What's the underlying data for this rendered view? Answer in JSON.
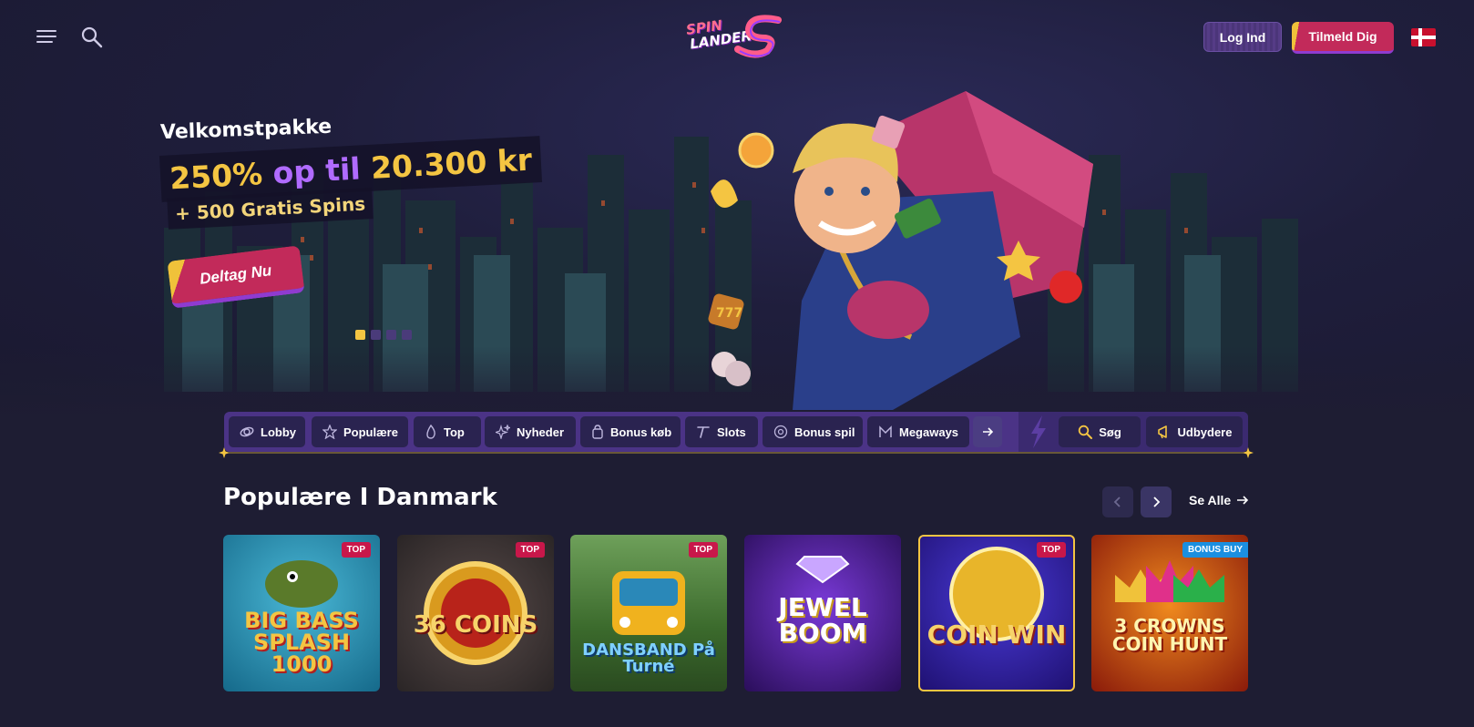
{
  "header": {
    "logo_line1": "SPIN",
    "logo_line2": "LANDER",
    "login_label": "Log Ind",
    "signup_label": "Tilmeld Dig",
    "language_flag": "denmark-flag"
  },
  "hero": {
    "label": "Velkomstpakke",
    "offer_part1": "250%",
    "offer_part2": "op til",
    "offer_part3": "20.300 kr",
    "spins": "+ 500 Gratis Spins",
    "cta_label": "Deltag Nu",
    "slides_total": 4,
    "slide_active": 1
  },
  "categories": [
    {
      "label": "Lobby",
      "icon": "lobby-icon"
    },
    {
      "label": "Populære",
      "icon": "star-icon"
    },
    {
      "label": "Top",
      "icon": "flame-icon"
    },
    {
      "label": "Nyheder",
      "icon": "sparkle-icon"
    },
    {
      "label": "Bonus køb",
      "icon": "bag-icon"
    },
    {
      "label": "Slots",
      "icon": "slot-icon"
    },
    {
      "label": "Bonus spil",
      "icon": "coin-icon"
    },
    {
      "label": "Megaways",
      "icon": "megaways-icon"
    }
  ],
  "category_tools": {
    "search_label": "Søg",
    "providers_label": "Udbydere"
  },
  "section": {
    "title": "Populære I Danmark",
    "see_all_label": "Se Alle"
  },
  "games": [
    {
      "title": "BIG BASS SPLASH 1000",
      "badge": "TOP",
      "bg": "#1d8fb0"
    },
    {
      "title": "36 COINS",
      "badge": "TOP",
      "bg": "#3a3436"
    },
    {
      "title": "DANSBAND På Turné",
      "badge": "TOP",
      "bg": "#4c7a3a"
    },
    {
      "title": "JEWEL BOOM",
      "badge": "",
      "bg": "#3b1c7a"
    },
    {
      "title": "COIN WIN",
      "badge": "TOP",
      "bg": "#2f1d8a"
    },
    {
      "title": "3 CROWNS COIN HUNT",
      "badge": "BONUS BUY",
      "bg": "#b3260f"
    }
  ]
}
